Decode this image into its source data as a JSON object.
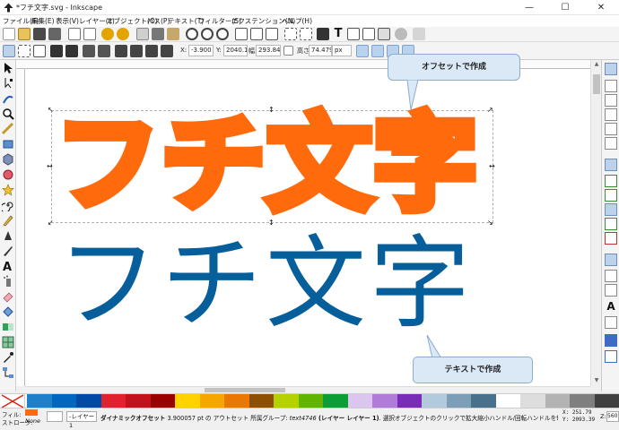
{
  "window": {
    "title": "*フチ文字.svg - Inkscape",
    "minimize": "—",
    "maximize": "☐",
    "close": "✕"
  },
  "menu": [
    "ファイル(F)",
    "編集(E)",
    "表示(V)",
    "レイヤー(L)",
    "オブジェクト(O)",
    "パス(P)",
    "テキスト(T)",
    "フィルター(S)",
    "エクステンション(N)",
    "ヘルプ(H)"
  ],
  "controls": {
    "x_label": "X:",
    "x_value": "-3.900",
    "y_label": "Y:",
    "y_value": "2040.1(",
    "w_label": "幅:",
    "w_value": "293.845",
    "h_label": "高さ:",
    "h_value": "74.479",
    "unit": "px"
  },
  "canvas": {
    "outset_text": "フチ文字",
    "plain_text": "フチ文字",
    "callout_top": "オフセットで作成",
    "callout_bottom": "テキストで作成",
    "outset_color": "#ff6a0c",
    "plain_color": "#065e9a"
  },
  "status": {
    "fill_label": "フィル:",
    "stroke_label": "ストローク:",
    "stroke_value": "None",
    "layer_select": "-レイヤー1",
    "message_bold": "ダイナミックオフセット",
    "message_rest": " 3.900057 pt の アウトセット 所属グループ: ",
    "message_object": "text4746",
    "message_layer": " (レイヤー レイヤー 1)",
    "message_tail": ". 選択オブジェクトのクリックで拡大縮小ハンドル/回転ハンドルを切り替えます.",
    "cursor_x": "X: 251.79",
    "cursor_y": "Y: 2093.39",
    "zoom_label": "Z:",
    "zoom_value": "560"
  },
  "palette_colors": [
    "#1e7fcb",
    "#0066bf",
    "#004aa6",
    "#e2212e",
    "#c4121c",
    "#990000",
    "#ffd200",
    "#f7a600",
    "#e97700",
    "#8d4f00",
    "#b5d200",
    "#5fb500",
    "#0a9e34",
    "#dcc6f0",
    "#b17bd8",
    "#7a2bb7",
    "#b2cadb",
    "#7c9fb7",
    "#49718b",
    "#ffffff",
    "#dddddd",
    "#b3b3b3",
    "#7f7f7f",
    "#404040"
  ]
}
